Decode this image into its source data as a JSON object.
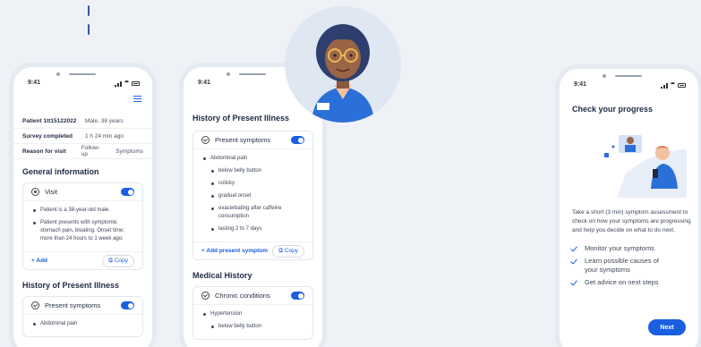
{
  "left_phone": {
    "time": "9:41",
    "summary": [
      {
        "key": "Patient 1tt15122022",
        "value": "Male, 38 years",
        "value2": ""
      },
      {
        "key": "Survey completed",
        "value": "1 h 24 min ago",
        "value2": ""
      },
      {
        "key": "Reason for visit",
        "value": "Follow-up",
        "value2": "Symptoms"
      }
    ],
    "general_title": "General information",
    "visit_card": {
      "label": "Visit",
      "items": [
        "Patient is a 38-year-old male.",
        "Patient presents with symptomic stomach pain, bloating. Onset time: more than 24 hours to 1 week ago."
      ],
      "add_label": "Add",
      "copy_label": "Copy"
    },
    "hpi_title": "History of Present Illness",
    "present_card": {
      "label": "Present symptoms",
      "first_item": "Abdominal pain"
    }
  },
  "middle_phone": {
    "time": "9:41",
    "hpi_title": "History of Present Illness",
    "present_card": {
      "label": "Present symptoms",
      "items": [
        {
          "text": "Abdominal pain",
          "sub": false
        },
        {
          "text": "below belly button",
          "sub": true
        },
        {
          "text": "colicky",
          "sub": true
        },
        {
          "text": "gradual onset",
          "sub": true
        },
        {
          "text": "exacerbating after caffeine consumption",
          "sub": true
        },
        {
          "text": "lasting 2 to 7 days",
          "sub": true
        }
      ],
      "add_label": "Add present symptom",
      "copy_label": "Copy"
    },
    "medical_title": "Medical History",
    "chronic_card": {
      "label": "Chronic conditions",
      "items": [
        {
          "text": "Hypertension",
          "sub": false
        },
        {
          "text": "below belly button",
          "sub": true
        }
      ]
    }
  },
  "right_phone": {
    "time": "9:41",
    "title": "Check your progress",
    "description": "Take a short (3 min) symptom assessment to check on how your symptoms are progressing and help you decide on what to do next.",
    "checklist": [
      "Monitor your symptoms",
      "Learn possible causes of your symptoms",
      "Get advice on next steps"
    ],
    "next_label": "Next"
  },
  "colors": {
    "accent": "#1a5fe0",
    "background": "#eef1f5"
  },
  "icons": [
    "menu-icon",
    "target-icon",
    "check-circle-icon",
    "copy-icon",
    "plus-icon",
    "check-icon"
  ]
}
